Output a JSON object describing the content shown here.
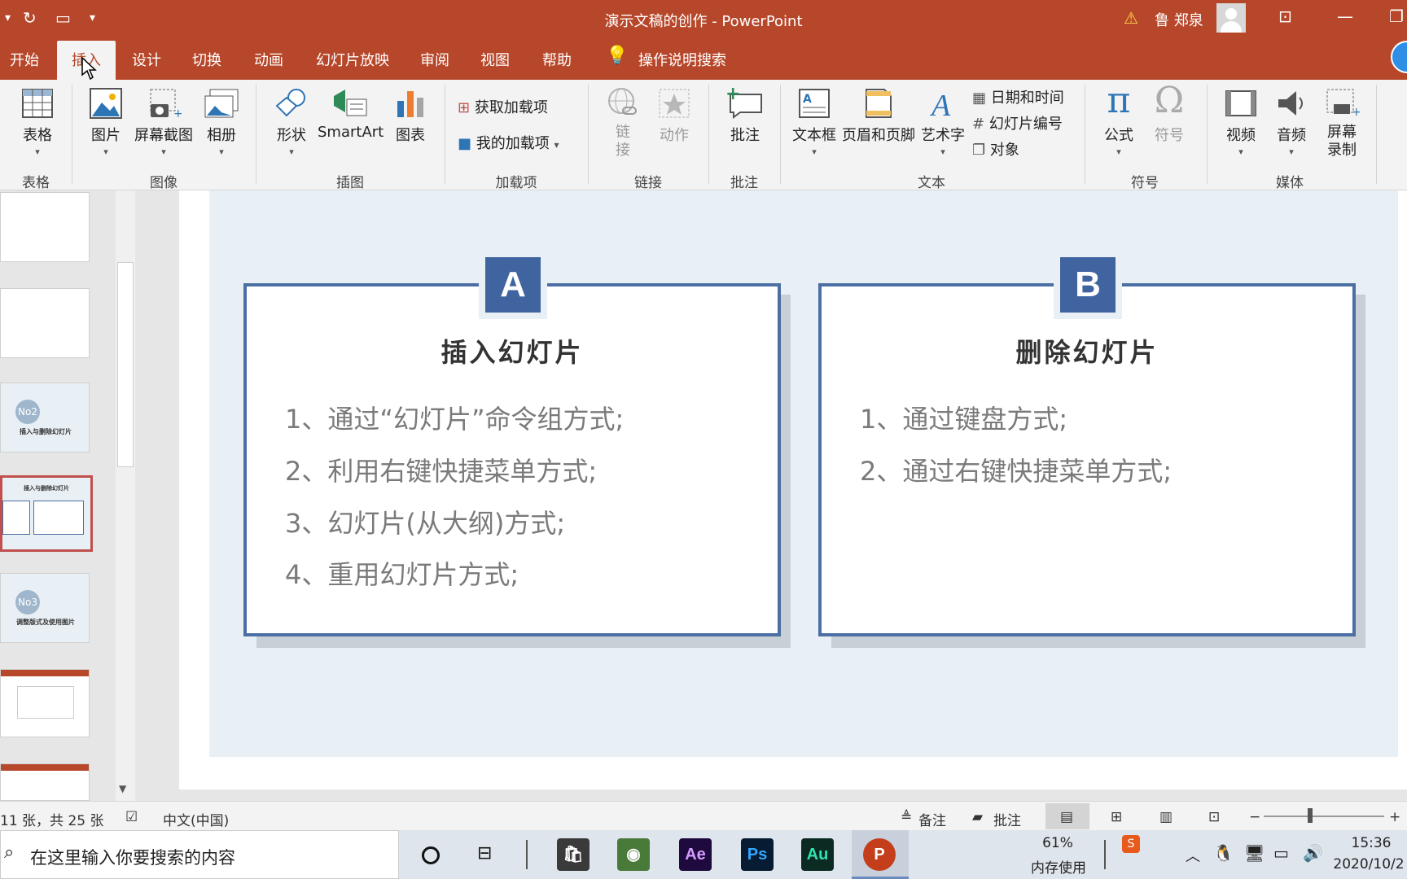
{
  "window": {
    "title": "演示文稿的创作  -  PowerPoint",
    "user": "鲁 郑泉",
    "accent": "#b7472a"
  },
  "tabs": [
    {
      "label": "开始"
    },
    {
      "label": "插入"
    },
    {
      "label": "设计"
    },
    {
      "label": "切换"
    },
    {
      "label": "动画"
    },
    {
      "label": "幻灯片放映"
    },
    {
      "label": "审阅"
    },
    {
      "label": "视图"
    },
    {
      "label": "帮助"
    },
    {
      "label": "操作说明搜索"
    }
  ],
  "ribbon": {
    "table": {
      "btn": "表格",
      "group": "表格"
    },
    "images": {
      "picture": "图片",
      "screenshot": "屏幕截图",
      "album": "相册",
      "group": "图像"
    },
    "illustrations": {
      "shapes": "形状",
      "smartart": "SmartArt",
      "chart": "图表",
      "group": "插图"
    },
    "addins": {
      "get": "获取加载项",
      "mine": "我的加载项",
      "group": "加载项"
    },
    "links": {
      "link": "链\n接",
      "link_a": "链",
      "link_b": "接",
      "action": "动作",
      "group": "链接"
    },
    "comments": {
      "comment": "批注",
      "group": "批注"
    },
    "text": {
      "textbox": "文本框",
      "headerfooter": "页眉和页脚",
      "wordart": "艺术字",
      "datetime": "日期和时间",
      "slidenum": "幻灯片编号",
      "object": "对象",
      "group": "文本"
    },
    "symbols": {
      "equation": "公式",
      "symbol": "符号",
      "group": "符号"
    },
    "media": {
      "video": "视频",
      "audio": "音频",
      "record_a": "屏幕",
      "record_b": "录制",
      "group": "媒体"
    }
  },
  "thumbnails": {
    "t3_badge": "No2",
    "t3_text": "插入与删除幻灯片",
    "t4_title": "插入与删除幻灯片",
    "t5_badge": "No3",
    "t5_text": "调整版式及使用图片"
  },
  "slide": {
    "card_a": {
      "badge": "A",
      "title": "插入幻灯片",
      "items": [
        "1、通过“幻灯片”命令组方式;",
        "2、利用右键快捷菜单方式;",
        "3、幻灯片(从大纲)方式;",
        "4、重用幻灯片方式;"
      ]
    },
    "card_b": {
      "badge": "B",
      "title": "删除幻灯片",
      "items": [
        "1、通过键盘方式;",
        "2、通过右键快捷菜单方式;"
      ]
    }
  },
  "statusbar": {
    "slide_count": "11 张，共 25 张",
    "language": "中文(中国)",
    "notes": "备注",
    "comments": "批注"
  },
  "taskbar": {
    "search_placeholder": "在这里输入你要搜索的内容",
    "apps": [
      "Ae",
      "Ps",
      "Au",
      "P"
    ],
    "memory_pct": "61%",
    "memory_label": "内存使用",
    "time": "15:36",
    "date": "2020/10/2"
  }
}
